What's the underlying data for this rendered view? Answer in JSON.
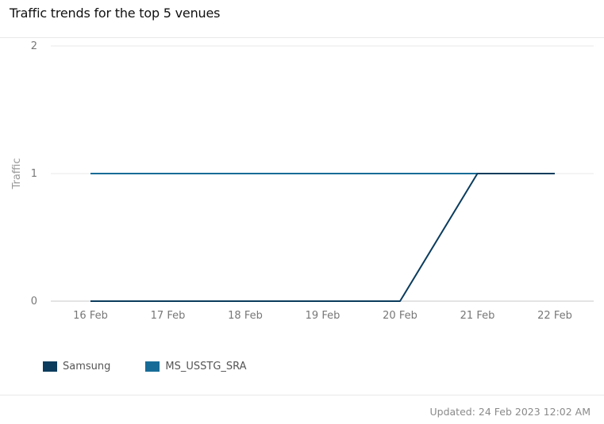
{
  "header": {
    "title": "Traffic trends for the top 5 venues"
  },
  "footer": {
    "updated": "Updated: 24 Feb 2023 12:02 AM"
  },
  "chart_data": {
    "type": "line",
    "title": "Traffic trends for the top 5 venues",
    "xlabel": "",
    "ylabel": "Traffic",
    "categories": [
      "16 Feb",
      "17 Feb",
      "18 Feb",
      "19 Feb",
      "20 Feb",
      "21 Feb",
      "22 Feb"
    ],
    "ylim": [
      0,
      2
    ],
    "yticks": [
      "0",
      "1",
      "2"
    ],
    "grid": true,
    "legend_position": "bottom-left",
    "series": [
      {
        "name": "Samsung",
        "color": "#0b3c5d",
        "values": [
          0,
          0,
          0,
          0,
          0,
          1,
          1
        ]
      },
      {
        "name": "MS_USSTG_SRA",
        "color": "#176c97",
        "values": [
          1,
          1,
          1,
          1,
          1,
          1,
          1
        ]
      }
    ]
  }
}
